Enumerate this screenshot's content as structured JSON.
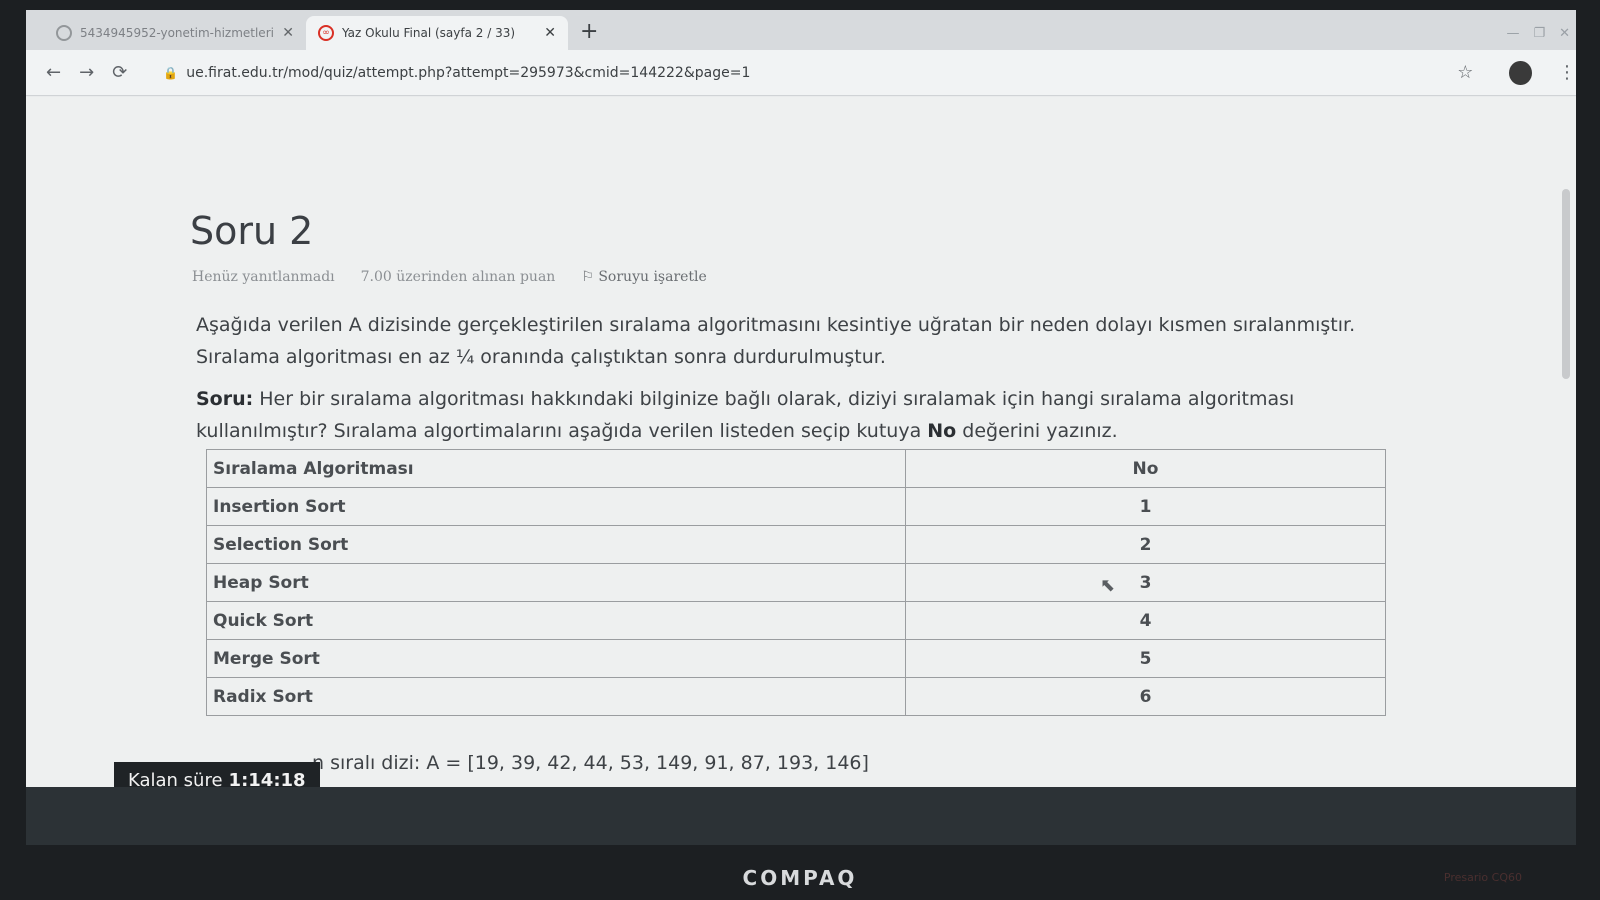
{
  "browser": {
    "tabs": [
      {
        "title": "5434945952-yonetim-hizmetleri",
        "active": false
      },
      {
        "title": "Yaz Okulu Final (sayfa 2 / 33)",
        "active": true
      }
    ],
    "new_tab": "+",
    "close_glyph": "✕",
    "url": "ue.firat.edu.tr/mod/quiz/attempt.php?attempt=295973&cmid=144222&page=1"
  },
  "question": {
    "title": "Soru 2",
    "status": "Henüz yanıtlanmadı",
    "points": "7.00 üzerinden alınan puan",
    "flag": "Soruyu işaretle",
    "paragraph1": "Aşağıda verilen A dizisinde gerçekleştirilen sıralama algoritmasını kesintiye uğratan bir neden dolayı kısmen sıralanmıştır. Sıralama algoritması en az ¼ oranında çalıştıktan sonra durdurulmuştur.",
    "paragraph2_label": "Soru:",
    "paragraph2_pre": " Her bir sıralama algoritması hakkındaki bilginize bağlı olarak, diziyi sıralamak için hangi sıralama algoritması kullanılmıştır? Sıralama algortimalarını aşağıda verilen listeden seçip kutuya ",
    "paragraph2_bold": "No",
    "paragraph2_post": " değerini yazınız.",
    "table": {
      "headers": [
        "Sıralama Algoritması",
        "No"
      ],
      "rows": [
        [
          "Insertion Sort",
          "1"
        ],
        [
          "Selection Sort",
          "2"
        ],
        [
          "Heap Sort",
          "3"
        ],
        [
          "Quick Sort",
          "4"
        ],
        [
          "Merge Sort",
          "5"
        ],
        [
          "Radix Sort",
          "6"
        ]
      ]
    },
    "array_text": "n sıralı dizi: A = [19, 39, 42, 44, 53, 149, 91, 87, 193, 146]"
  },
  "timer": {
    "label": "Kalan süre",
    "value": "1:14:18"
  },
  "bezel": {
    "brand": "COMPAQ",
    "model": "Presario CQ60"
  }
}
